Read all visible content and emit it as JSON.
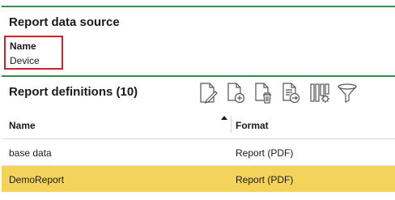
{
  "report_data_source": {
    "title": "Report data source",
    "name_label": "Name",
    "name_value": "Device"
  },
  "report_definitions": {
    "title": "Report definitions (10)",
    "toolbar": [
      {
        "icon": "edit-document-icon"
      },
      {
        "icon": "add-document-icon"
      },
      {
        "icon": "delete-document-icon"
      },
      {
        "icon": "export-document-icon"
      },
      {
        "icon": "column-settings-icon"
      },
      {
        "icon": "filter-icon"
      }
    ],
    "columns": [
      "Name",
      "Format"
    ],
    "rows": [
      {
        "name": "base data",
        "format": "Report (PDF)",
        "selected": false
      },
      {
        "name": "DemoReport",
        "format": "Report (PDF)",
        "selected": true
      }
    ]
  },
  "colors": {
    "divider": "#2f8f4e",
    "highlight_box": "#d0202a",
    "selected_row": "#f3d35a"
  }
}
